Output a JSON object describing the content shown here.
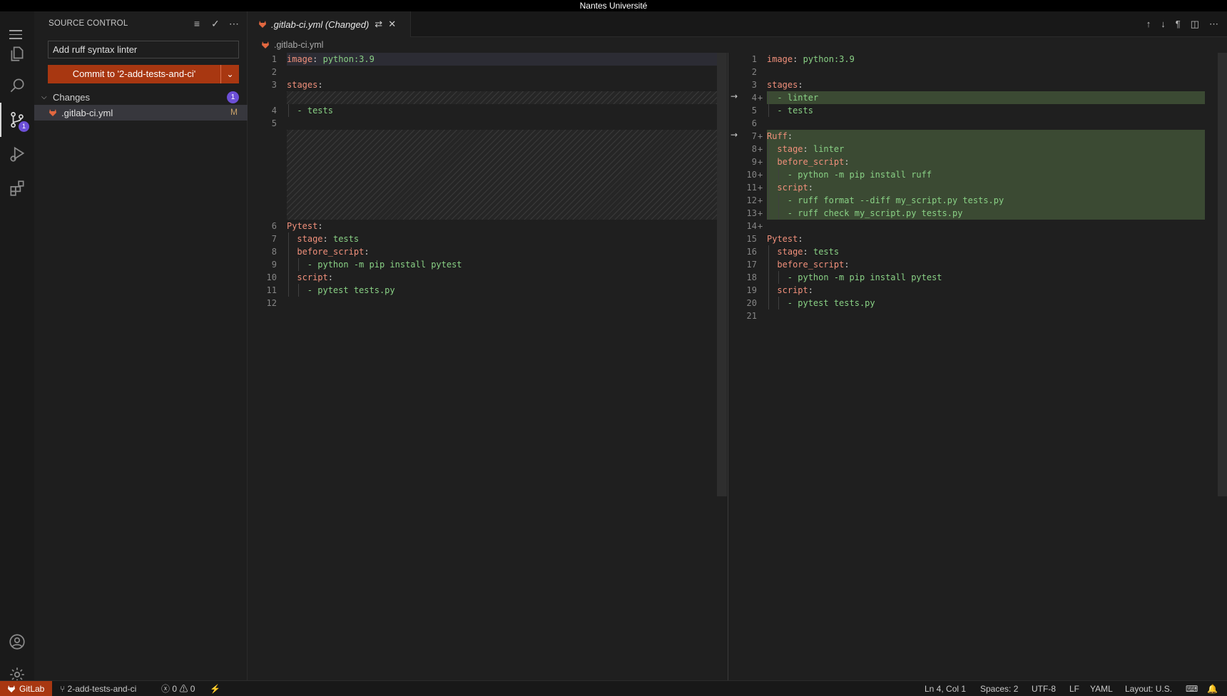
{
  "window": {
    "title": "Nantes Université"
  },
  "activity_bar": {
    "items": [
      {
        "name": "explorer-icon"
      },
      {
        "name": "search-icon"
      },
      {
        "name": "source-control-icon",
        "badge": "1"
      },
      {
        "name": "run-debug-icon"
      },
      {
        "name": "extensions-icon"
      }
    ]
  },
  "sidebar": {
    "title": "SOURCE CONTROL",
    "commit_message": "Add ruff syntax linter",
    "commit_button": "Commit to '2-add-tests-and-ci'",
    "changes_label": "Changes",
    "changes_count": "1",
    "file": {
      "name": ".gitlab-ci.yml",
      "status": "M"
    }
  },
  "editor": {
    "tab_label": ".gitlab-ci.yml (Changed)",
    "breadcrumb": ".gitlab-ci.yml",
    "left_lines": [
      {
        "n": "1",
        "k": "image",
        "v": "python:3.9"
      },
      {
        "n": "2"
      },
      {
        "n": "3",
        "k": "stages"
      },
      {
        "n": "4",
        "v": "- tests"
      },
      {
        "n": "5"
      },
      {
        "n": "6",
        "k": "Pytest"
      },
      {
        "n": "7",
        "k": "stage",
        "v": "tests"
      },
      {
        "n": "8",
        "k": "before_script"
      },
      {
        "n": "9",
        "v": "- python -m pip install pytest"
      },
      {
        "n": "10",
        "k": "script"
      },
      {
        "n": "11",
        "v": "- pytest tests.py"
      },
      {
        "n": "12"
      }
    ],
    "right_lines": [
      {
        "n": "1",
        "k": "image",
        "v": "python:3.9"
      },
      {
        "n": "2"
      },
      {
        "n": "3",
        "k": "stages"
      },
      {
        "n": "4",
        "v": "- linter"
      },
      {
        "n": "5",
        "v": "- tests"
      },
      {
        "n": "6"
      },
      {
        "n": "7",
        "k": "Ruff"
      },
      {
        "n": "8",
        "k": "stage",
        "v": "linter"
      },
      {
        "n": "9",
        "k": "before_script"
      },
      {
        "n": "10",
        "v": "- python -m pip install ruff"
      },
      {
        "n": "11",
        "k": "script"
      },
      {
        "n": "12",
        "v": "- ruff format --diff my_script.py tests.py"
      },
      {
        "n": "13",
        "v": "- ruff check my_script.py tests.py"
      },
      {
        "n": "14"
      },
      {
        "n": "15",
        "k": "Pytest"
      },
      {
        "n": "16",
        "k": "stage",
        "v": "tests"
      },
      {
        "n": "17",
        "k": "before_script"
      },
      {
        "n": "18",
        "v": "- python -m pip install pytest"
      },
      {
        "n": "19",
        "k": "script"
      },
      {
        "n": "20",
        "v": "- pytest tests.py"
      },
      {
        "n": "21"
      }
    ]
  },
  "status_bar": {
    "remote": "GitLab",
    "branch": "2-add-tests-and-ci",
    "errors": "0",
    "warnings": "0",
    "position": "Ln 4, Col 1",
    "spaces": "Spaces: 2",
    "encoding": "UTF-8",
    "eol": "LF",
    "language": "YAML",
    "layout": "Layout: U.S."
  },
  "colors": {
    "accent": "#a83711",
    "badge": "#6c4fd6",
    "added_bg": "#3b4a33",
    "key": "#f1907b",
    "value": "#89d185"
  }
}
